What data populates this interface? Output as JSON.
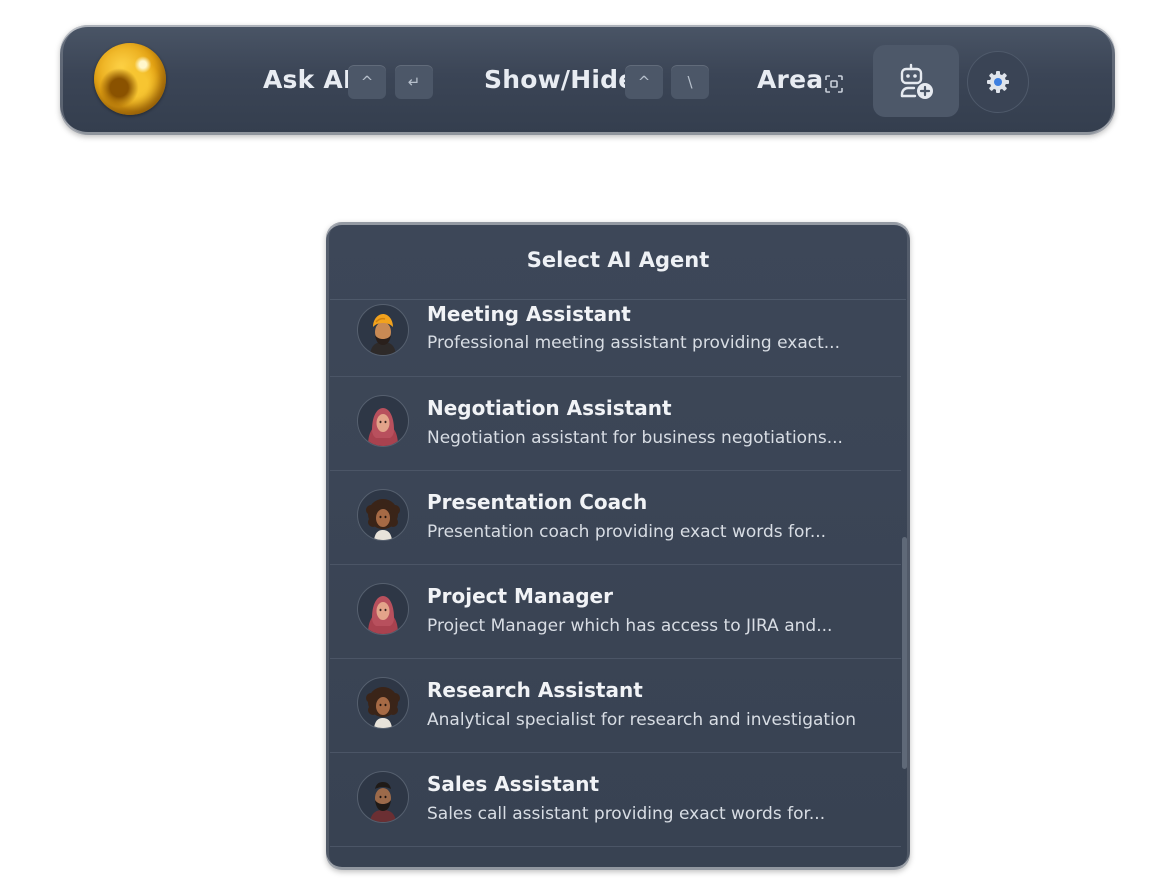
{
  "toolbar": {
    "ask_ai_label": "Ask AI",
    "ask_ai_keys": [
      "^",
      "↵"
    ],
    "show_hide_label": "Show/Hide",
    "show_hide_keys": [
      "^",
      "\\"
    ],
    "area_label": "Area",
    "icons": {
      "logo": "gold-orb-logo",
      "area": "screen-capture-icon",
      "agent": "add-agent-robot-icon",
      "settings": "gear-icon"
    }
  },
  "panel": {
    "title": "Select AI Agent",
    "agents": [
      {
        "name": "Meeting Assistant",
        "description": "Professional meeting assistant providing exact...",
        "avatar": "turban-man-avatar"
      },
      {
        "name": "Negotiation Assistant",
        "description": "Negotiation assistant for business negotiations...",
        "avatar": "hijab-woman-avatar"
      },
      {
        "name": "Presentation Coach",
        "description": "Presentation coach providing exact words for...",
        "avatar": "curly-hair-woman-avatar"
      },
      {
        "name": "Project Manager",
        "description": "Project Manager which has access to JIRA and...",
        "avatar": "hijab-woman-avatar"
      },
      {
        "name": "Research Assistant",
        "description": "Analytical specialist for research and investigation",
        "avatar": "curly-hair-woman-avatar"
      },
      {
        "name": "Sales Assistant",
        "description": "Sales call assistant providing exact words for...",
        "avatar": "bearded-man-avatar"
      }
    ]
  },
  "colors": {
    "toolbar_bg": "#3b4556",
    "panel_bg": "#3a4454",
    "text_primary": "#eef1f5",
    "text_secondary": "#d8dde4",
    "logo_gold": "#e5a312"
  }
}
